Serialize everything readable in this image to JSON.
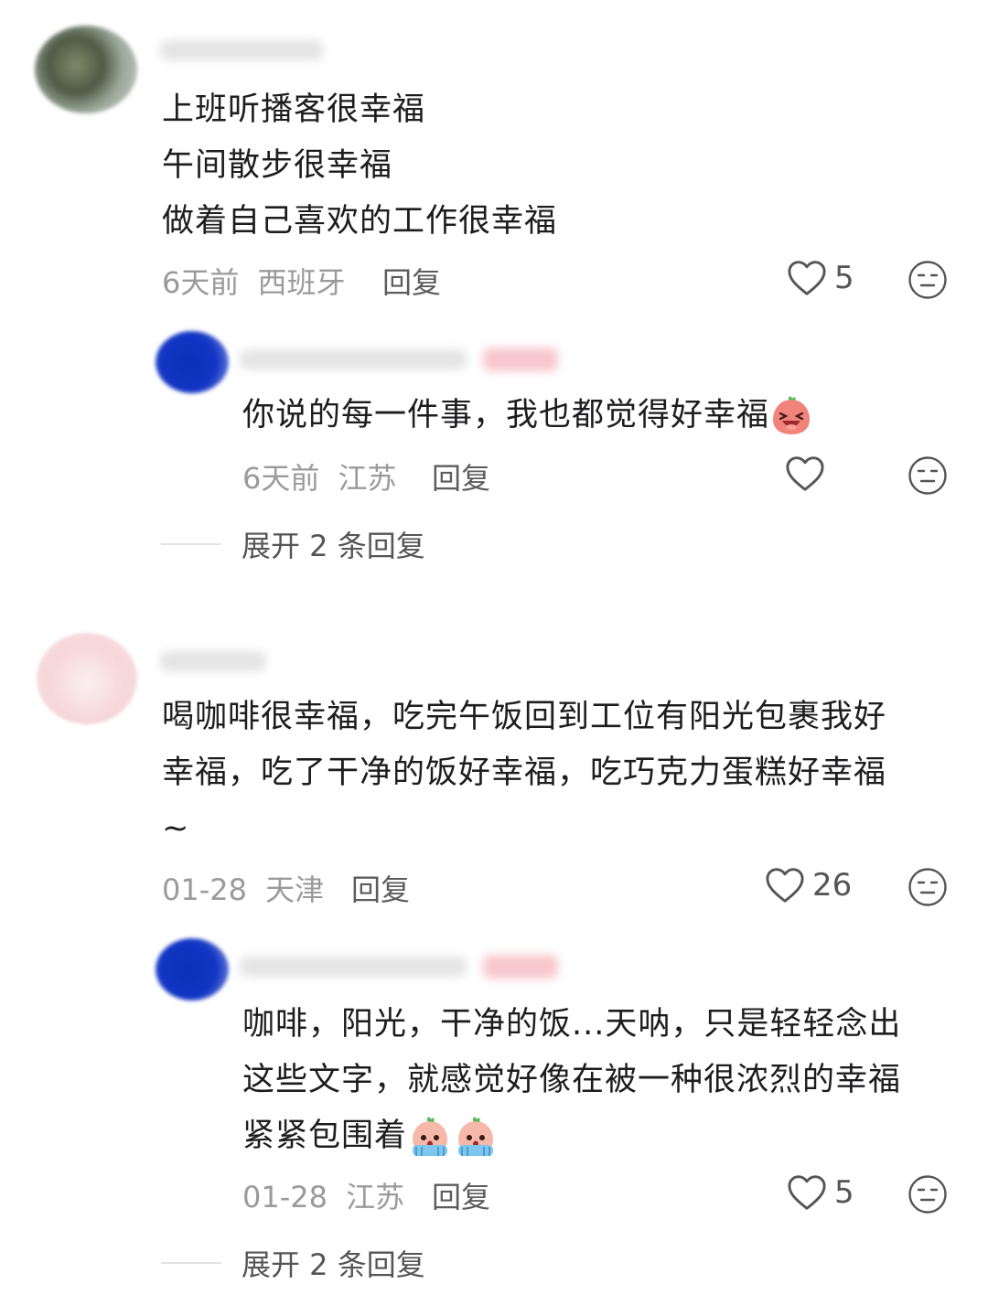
{
  "comments": [
    {
      "text_lines": [
        "上班听播客很幸福",
        "午间散步很幸福",
        "做着自己喜欢的工作很幸福"
      ],
      "time": "6天前",
      "location": "西班牙",
      "reply_label": "回复",
      "likes": "5",
      "reply": {
        "text": "你说的每一件事，我也都觉得好幸福",
        "time": "6天前",
        "location": "江苏",
        "reply_label": "回复",
        "likes": ""
      },
      "expand_label": "展开 2 条回复"
    },
    {
      "text_lines": [
        "喝咖啡很幸福，吃完午饭回到工位有阳光包裹我好",
        "幸福，吃了干净的饭好幸福，吃巧克力蛋糕好幸福",
        "~"
      ],
      "time": "01-28",
      "location": "天津",
      "reply_label": "回复",
      "likes": "26",
      "reply": {
        "text_lines": [
          "咖啡，阳光，干净的饭...天呐，只是轻轻念出",
          "这些文字，就感觉好像在被一种很浓烈的幸福",
          "紧紧包围着"
        ],
        "time": "01-28",
        "location": "江苏",
        "reply_label": "回复",
        "likes": "5"
      },
      "expand_label": "展开 2 条回复"
    }
  ],
  "colors": {
    "text": "#1d1d1f",
    "meta": "#9a9a9a",
    "icon": "#555555",
    "author_tag": "#f7c1c8",
    "reply_avatar": "#1236c4"
  },
  "icons": [
    "heart-outline-icon",
    "expressionless-emoji-icon",
    "laughing-emoji-icon",
    "crying-emoji-icon"
  ]
}
